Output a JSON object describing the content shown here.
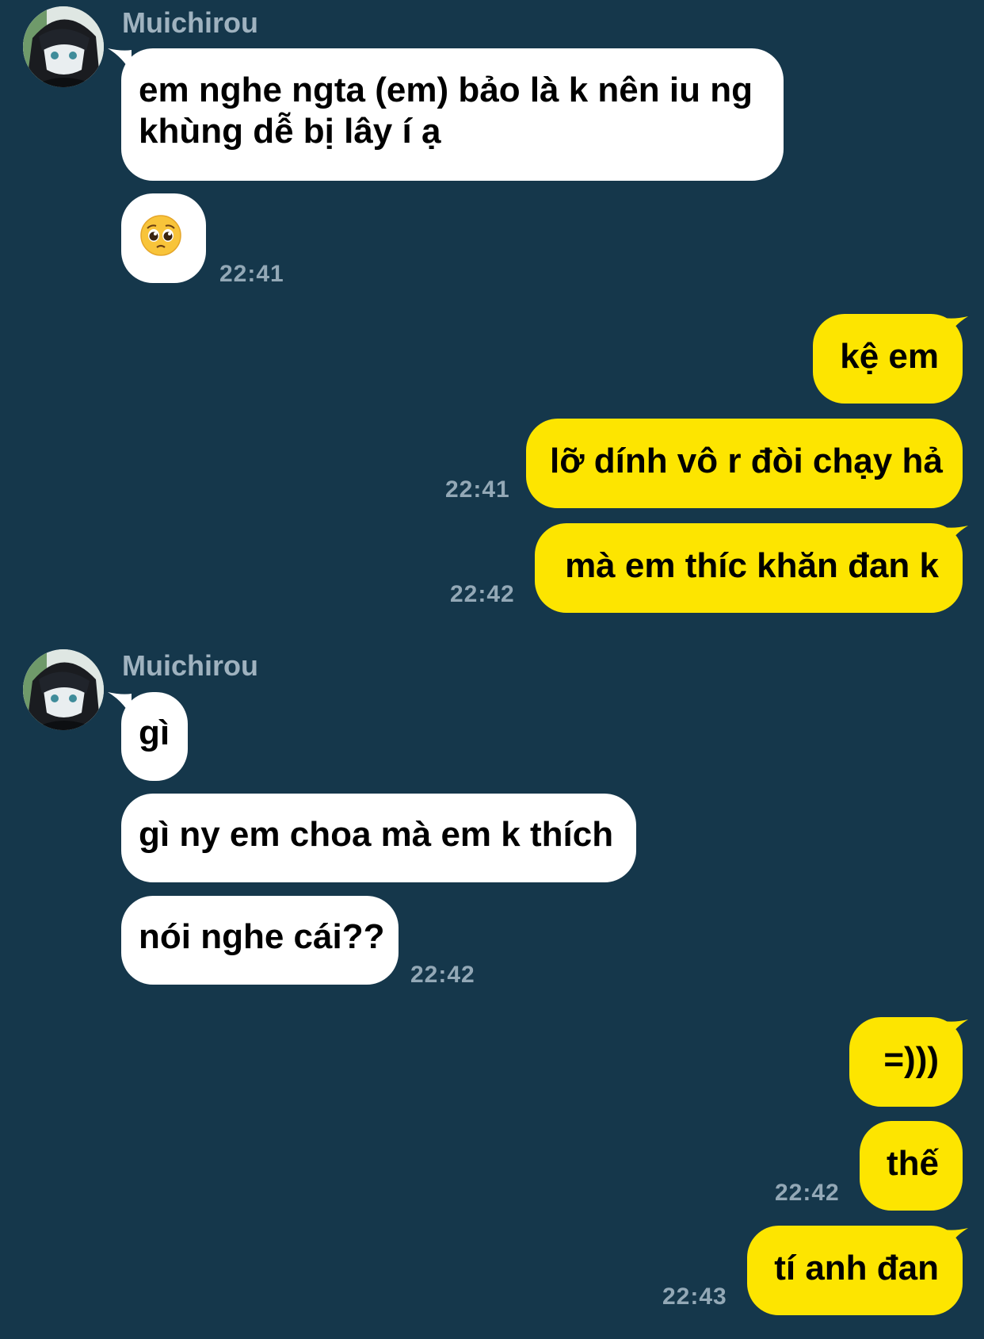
{
  "colors": {
    "background": "#15374b",
    "incoming_bubble": "#ffffff",
    "outgoing_bubble": "#fde500",
    "sender_name": "#9fb2bf",
    "timestamp": "#93a8b6"
  },
  "icons": {
    "avatar": "anime-avatar-image",
    "emoji": "pleading-face-emoji"
  },
  "chat": {
    "groups": [
      {
        "sender": "Muichirou",
        "messages": [
          "em nghe ngta (em) bảo là k nên iu ng khùng dễ bị lây í ạ",
          "🥺"
        ],
        "time": "22:41"
      },
      {
        "sender": "me",
        "messages": [
          "kệ em",
          "lỡ dính vô r đòi chạy hả"
        ],
        "time": "22:41"
      },
      {
        "sender": "me",
        "messages": [
          "mà em thíc khăn đan k"
        ],
        "time": "22:42"
      },
      {
        "sender": "Muichirou",
        "messages": [
          "gì",
          "gì ny em choa mà em k thích",
          "nói nghe cái??"
        ],
        "time": "22:42"
      },
      {
        "sender": "me",
        "messages": [
          "=)))",
          "thế"
        ],
        "time": "22:42"
      },
      {
        "sender": "me",
        "messages": [
          "tí anh đan"
        ],
        "time": "22:43"
      }
    ]
  }
}
